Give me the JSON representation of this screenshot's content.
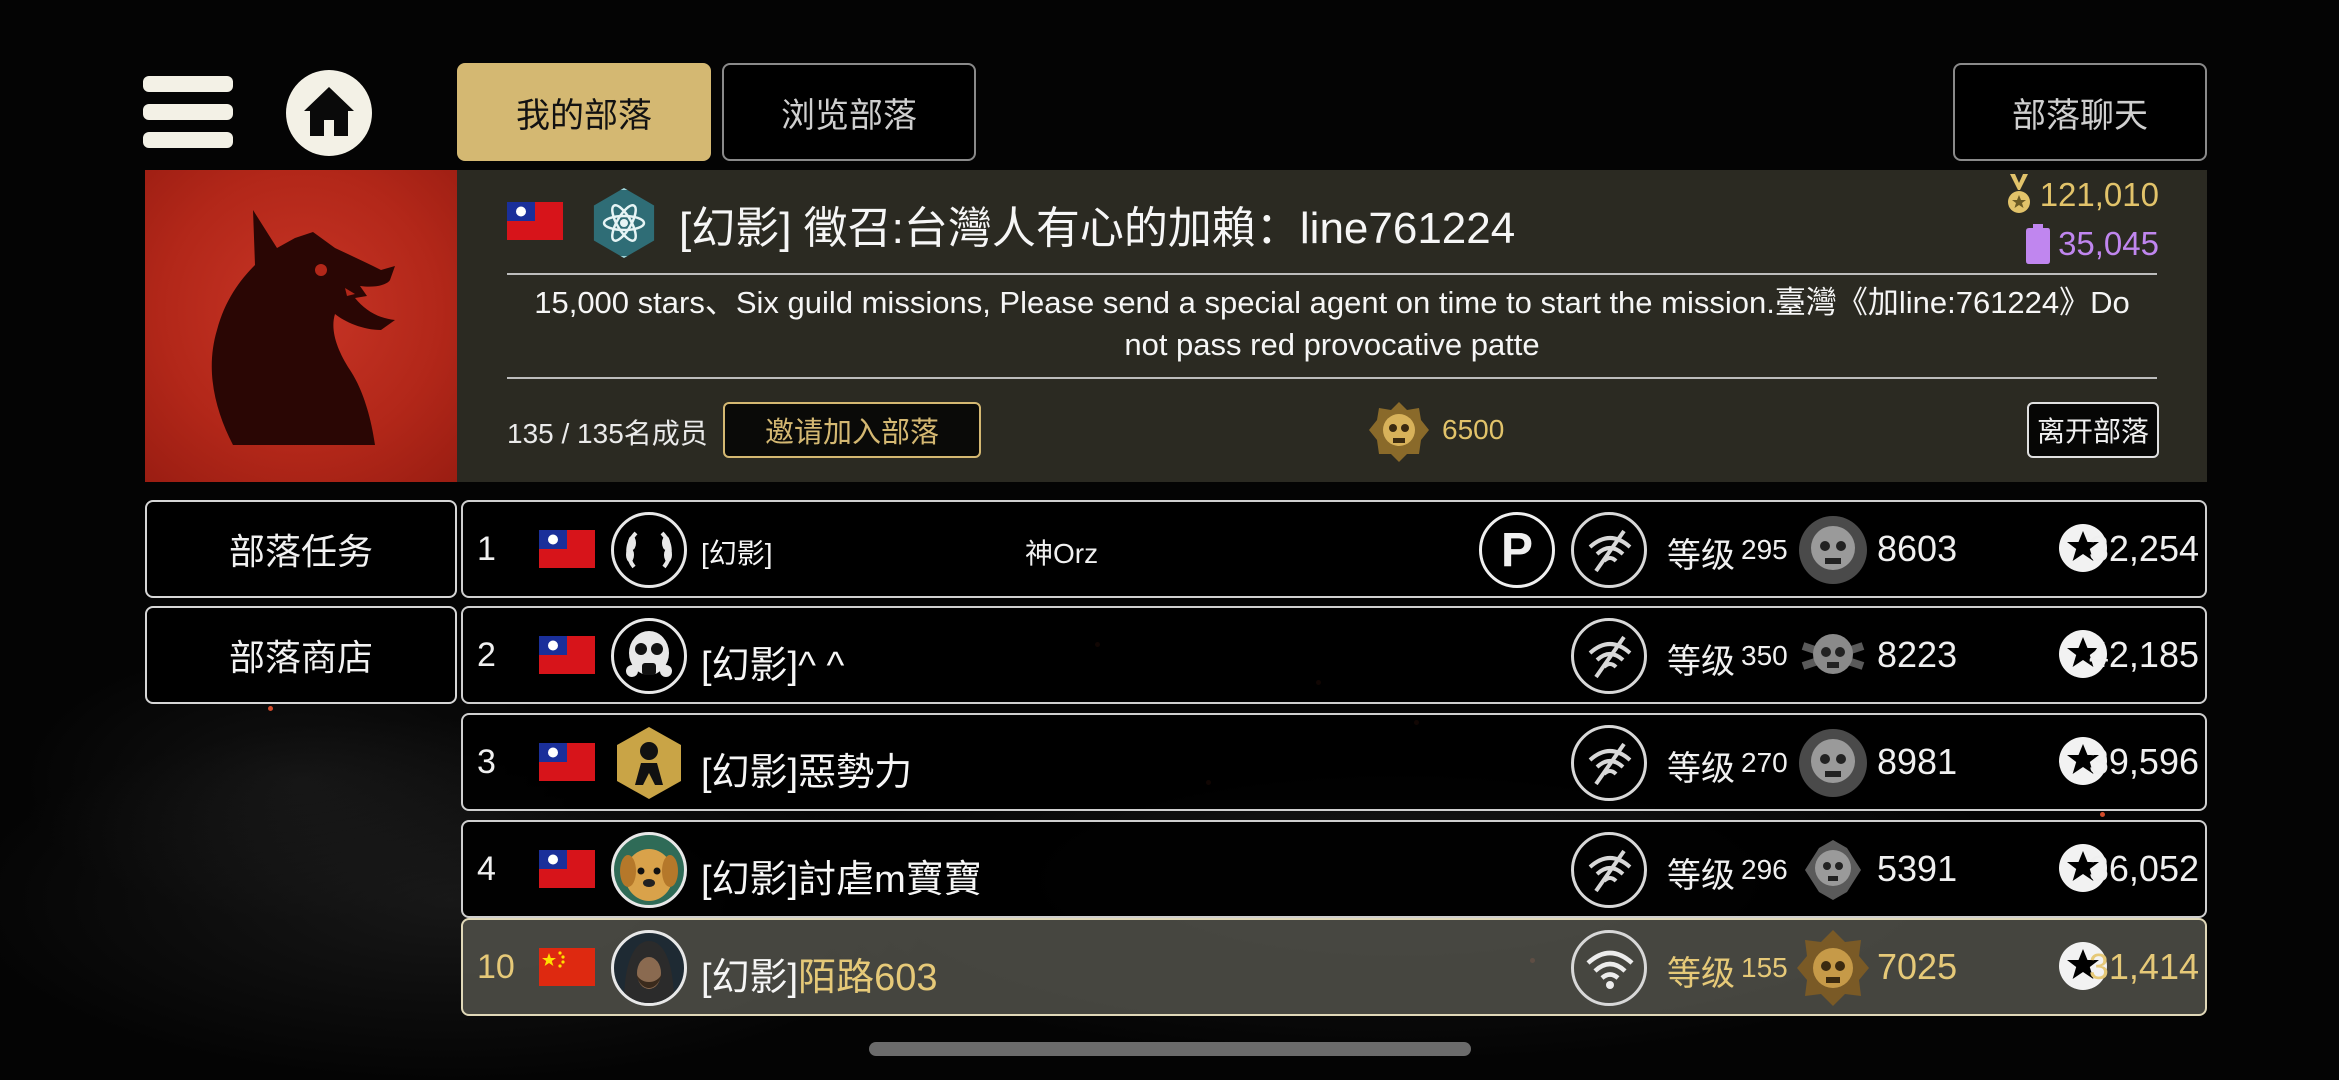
{
  "tabs": {
    "my_clan": "我的部落",
    "browse": "浏览部落",
    "chat": "部落聊天"
  },
  "icons": {
    "menu": "hamburger-icon",
    "home": "home-icon",
    "flag_tw": "taiwan-flag",
    "flag_cn": "china-flag",
    "clan": "atom-icon",
    "trophy": "medal-icon",
    "gem": "gem-icon",
    "star": "star-icon",
    "wifi": "wifi-icon"
  },
  "clan": {
    "title": "[幻影] 徵召:台灣人有心的加賴：line761224",
    "description": "15,000 stars、Six guild missions,  Please send a special agent on time to start the mission.臺灣《加line:761224》Do not pass red provocative patte",
    "trophies": "121,010",
    "gems": "35,045",
    "member_count": "135 / 135名成员",
    "invite_label": "邀请加入部落",
    "rank_score": "6500",
    "leave_label": "离开部落"
  },
  "side": {
    "missions": "部落任务",
    "shop": "部落商店"
  },
  "members": [
    {
      "rank": "1",
      "name": "[幻影]",
      "title": "神Orz",
      "level_label": "等级",
      "level": "295",
      "skill": "8603",
      "stars": "32,254",
      "online": false,
      "premium": true
    },
    {
      "rank": "2",
      "name": "[幻影]^ ^",
      "title": "",
      "level_label": "等级",
      "level": "350",
      "skill": "8223",
      "stars": "42,185",
      "online": false,
      "premium": false
    },
    {
      "rank": "3",
      "name": "[幻影]惡勢力",
      "title": "",
      "level_label": "等级",
      "level": "270",
      "skill": "8981",
      "stars": "39,596",
      "online": false,
      "premium": false
    },
    {
      "rank": "4",
      "name": "[幻影]討虐m寶寶",
      "title": "",
      "level_label": "等级",
      "level": "296",
      "skill": "5391",
      "stars": "36,052",
      "online": false,
      "premium": false
    },
    {
      "rank": "10",
      "name_prefix": "[幻影]",
      "name_suffix": "陌路603",
      "level_label": "等级",
      "level": "155",
      "skill": "7025",
      "stars": "31,414",
      "online": true,
      "premium": false
    }
  ],
  "colors": {
    "gold": "#d4b872",
    "emblem_red": "#b22719",
    "gem_purple": "#c086ef"
  }
}
